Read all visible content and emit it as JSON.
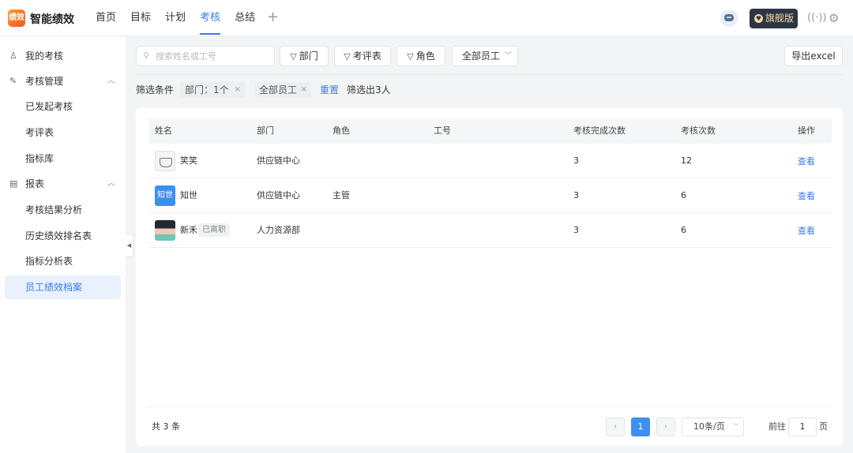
{
  "app": {
    "title": "智能绩效",
    "logo_text": "绩效"
  },
  "nav": [
    {
      "label": "首页"
    },
    {
      "label": "目标"
    },
    {
      "label": "计划"
    },
    {
      "label": "考核",
      "active": true
    },
    {
      "label": "总结"
    }
  ],
  "header": {
    "add_icon": "+",
    "flagship_label": "旗舰版",
    "flagship_badge": "♥",
    "signal_icon": "((·))",
    "gear_icon": "⚙",
    "robot_icon": "robot-icon"
  },
  "sidebar": {
    "my_review": "我的考核",
    "review_manage": "考核管理",
    "review_manage_items": [
      "已发起考核",
      "考评表",
      "指标库"
    ],
    "reports": "报表",
    "report_items": [
      "考核结果分析",
      "历史绩效排名表",
      "指标分析表",
      "员工绩效档案"
    ],
    "active_item": "员工绩效档案"
  },
  "toolbar": {
    "search_placeholder": "搜索姓名或工号",
    "dept_filter": "部门",
    "form_filter": "考评表",
    "role_filter": "角色",
    "employee_select": "全部员工",
    "export": "导出excel"
  },
  "filters": {
    "label": "筛选条件",
    "tags": [
      "部门：1个",
      "全部员工"
    ],
    "reset": "重置",
    "result": "筛选出3人"
  },
  "table": {
    "columns": [
      "姓名",
      "部门",
      "角色",
      "工号",
      "考核完成次数",
      "考核次数",
      "操作"
    ],
    "rows": [
      {
        "name": "笑笑",
        "avatar": "sketch",
        "dept": "供应链中心",
        "role": "",
        "emp_no": "",
        "completed": "3",
        "total": "12",
        "action": "查看",
        "badge": ""
      },
      {
        "name": "知世",
        "avatar": "text",
        "avatar_text": "知世",
        "dept": "供应链中心",
        "role": "主管",
        "emp_no": "",
        "completed": "3",
        "total": "6",
        "action": "查看",
        "badge": ""
      },
      {
        "name": "新禾",
        "avatar": "photo",
        "dept": "人力资源部",
        "role": "",
        "emp_no": "",
        "completed": "3",
        "total": "6",
        "action": "查看",
        "badge": "已离职"
      }
    ]
  },
  "pagination": {
    "total": "共 3 条",
    "prev": "‹",
    "current": "1",
    "next": "›",
    "page_size": "10条/页",
    "goto_label": "前往",
    "goto_value": "1",
    "page_unit": "页"
  }
}
